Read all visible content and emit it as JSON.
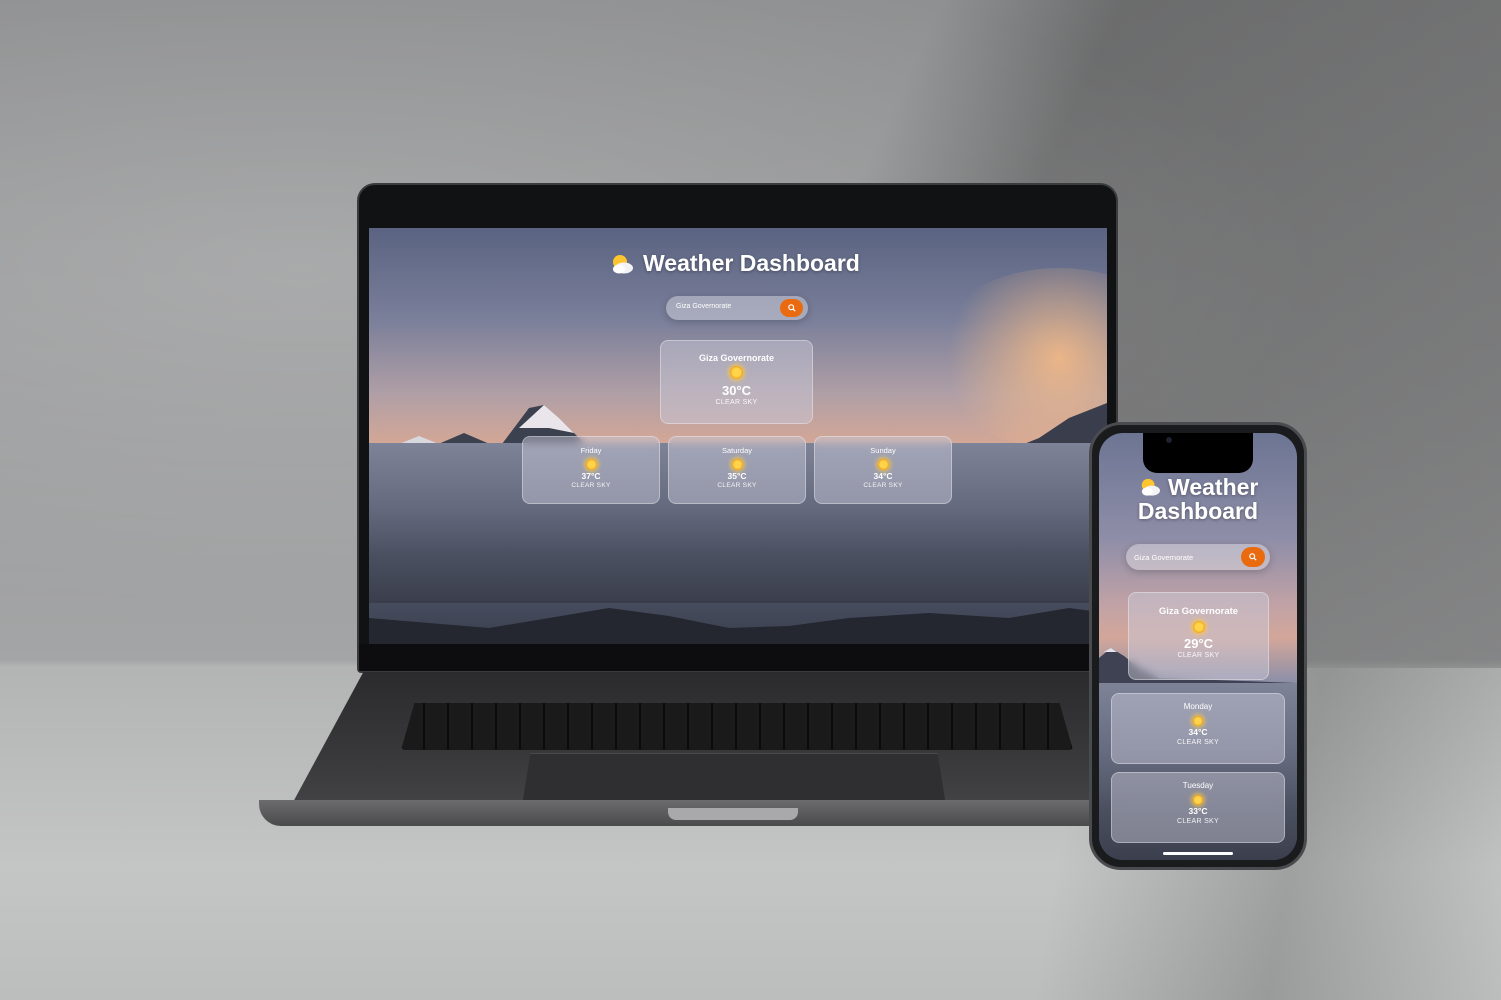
{
  "app": {
    "title": "Weather Dashboard",
    "icon": "sun-behind-cloud-icon"
  },
  "search": {
    "value": "Giza Governorate",
    "button_icon": "search-icon"
  },
  "desktop": {
    "current": {
      "city": "Giza Governorate",
      "icon": "sun-icon",
      "temperature": "30°C",
      "condition": "CLEAR SKY"
    },
    "forecast": [
      {
        "day": "Friday",
        "icon": "sun-icon",
        "temperature": "37°C",
        "condition": "CLEAR SKY"
      },
      {
        "day": "Saturday",
        "icon": "sun-icon",
        "temperature": "35°C",
        "condition": "CLEAR SKY"
      },
      {
        "day": "Sunday",
        "icon": "sun-icon",
        "temperature": "34°C",
        "condition": "CLEAR SKY"
      }
    ]
  },
  "mobile": {
    "title_line1": "Weather",
    "title_line2": "Dashboard",
    "current": {
      "city": "Giza Governorate",
      "icon": "sun-icon",
      "temperature": "29°C",
      "condition": "CLEAR SKY"
    },
    "forecast": [
      {
        "day": "Monday",
        "icon": "sun-icon",
        "temperature": "34°C",
        "condition": "CLEAR SKY"
      },
      {
        "day": "Tuesday",
        "icon": "sun-icon",
        "temperature": "33°C",
        "condition": "CLEAR SKY"
      }
    ]
  },
  "colors": {
    "accent": "#ea6a10",
    "card_bg": "rgba(205,205,220,0.45)",
    "text": "#ffffff"
  }
}
